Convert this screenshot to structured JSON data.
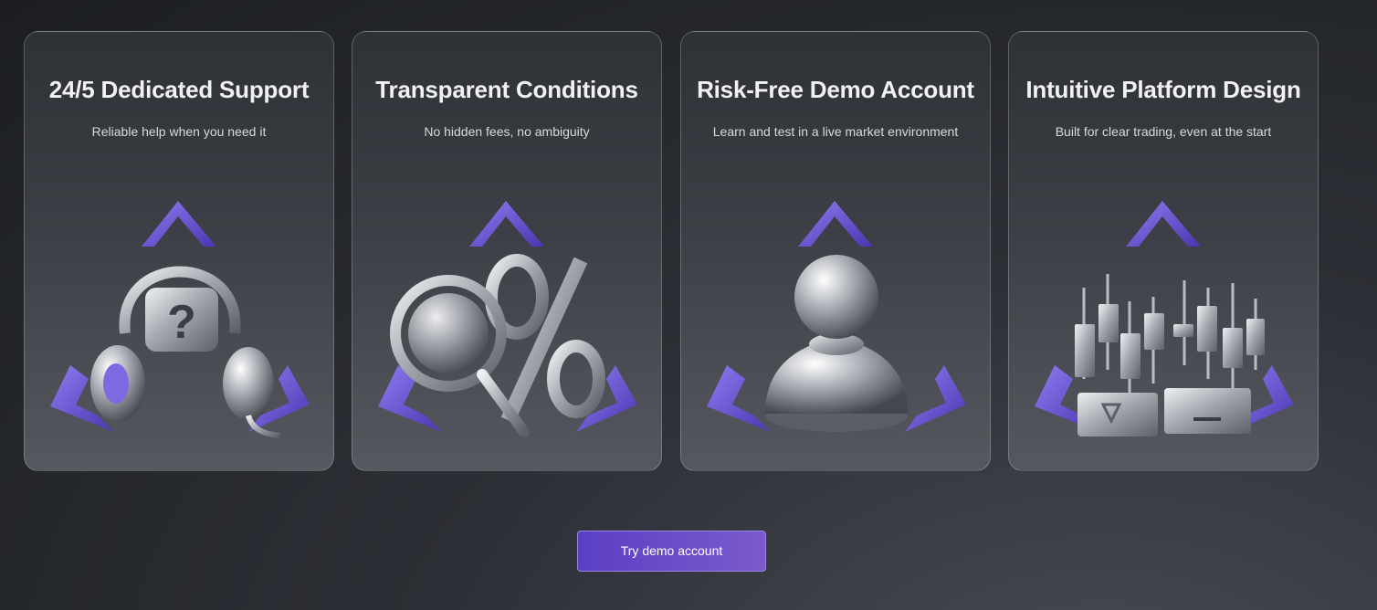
{
  "cards": [
    {
      "title": "24/5 Dedicated Support",
      "subtitle": "Reliable help when you need it",
      "icon": "headset-question-icon"
    },
    {
      "title": "Transparent Conditions",
      "subtitle": "No hidden fees, no ambiguity",
      "icon": "magnifier-percent-icon"
    },
    {
      "title": "Risk-Free Demo Account",
      "subtitle": "Learn and test in a live market environment",
      "icon": "pawn-icon"
    },
    {
      "title": "Intuitive Platform Design",
      "subtitle": "Built for clear trading, even at the start",
      "icon": "candlestick-chart-icon"
    }
  ],
  "cta": {
    "label": "Try demo account"
  },
  "colors": {
    "accent": "#6a4fd0",
    "purple_shape": "#7b66e0",
    "metal": "#c9ccd2"
  }
}
